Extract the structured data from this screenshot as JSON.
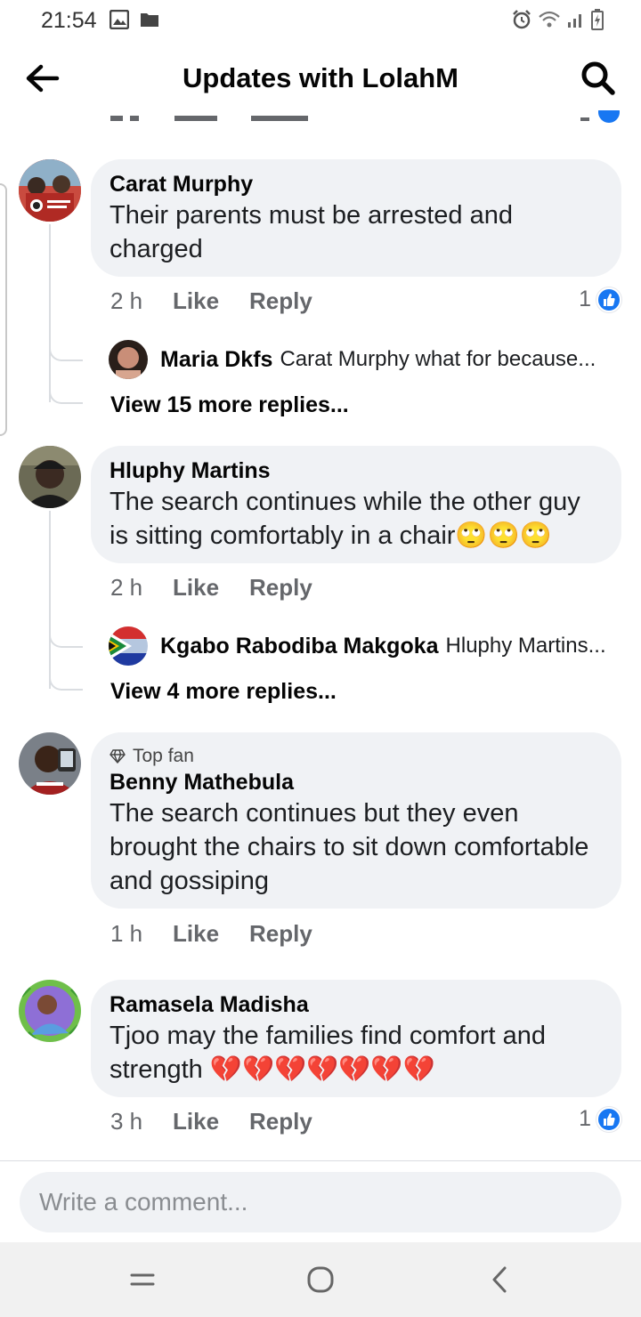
{
  "status_bar": {
    "time": "21:54",
    "left_icons": [
      "image-icon",
      "folder-icon"
    ],
    "right_icons": [
      "alarm-icon",
      "wifi-icon",
      "signal-icon",
      "battery-icon"
    ]
  },
  "header": {
    "title": "Updates with LolahM",
    "back_icon": "arrow-left-icon",
    "search_icon": "search-icon"
  },
  "comments": [
    {
      "author": "Carat Murphy",
      "text": "Their parents must be arrested and charged",
      "time": "2 h",
      "like_label": "Like",
      "reply_label": "Reply",
      "reaction_count": "1",
      "reply_preview": {
        "author": "Maria Dkfs",
        "snippet": "Carat Murphy what for because..."
      },
      "view_more": "View 15 more replies..."
    },
    {
      "author": "Hluphy Martins",
      "text": "The search continues while the other guy is sitting comfortably in a chair🙄🙄🙄",
      "time": "2 h",
      "like_label": "Like",
      "reply_label": "Reply",
      "reply_preview": {
        "author": "Kgabo Rabodiba Makgoka",
        "snippet": "Hluphy Martins..."
      },
      "view_more": "View 4 more replies..."
    },
    {
      "badge": "Top fan",
      "author": "Benny Mathebula",
      "text": "The search continues but they even brought the chairs to sit down comfortable and gossiping",
      "time": "1 h",
      "like_label": "Like",
      "reply_label": "Reply"
    },
    {
      "author": "Ramasela Madisha",
      "text": "Tjoo may the families find comfort and strength 💔💔💔💔💔💔💔",
      "time": "3 h",
      "like_label": "Like",
      "reply_label": "Reply",
      "reaction_count": "1"
    }
  ],
  "composer": {
    "placeholder": "Write a comment..."
  },
  "colors": {
    "like_blue": "#1877f2",
    "bubble": "#f0f2f5",
    "meta_gray": "#65676b"
  }
}
